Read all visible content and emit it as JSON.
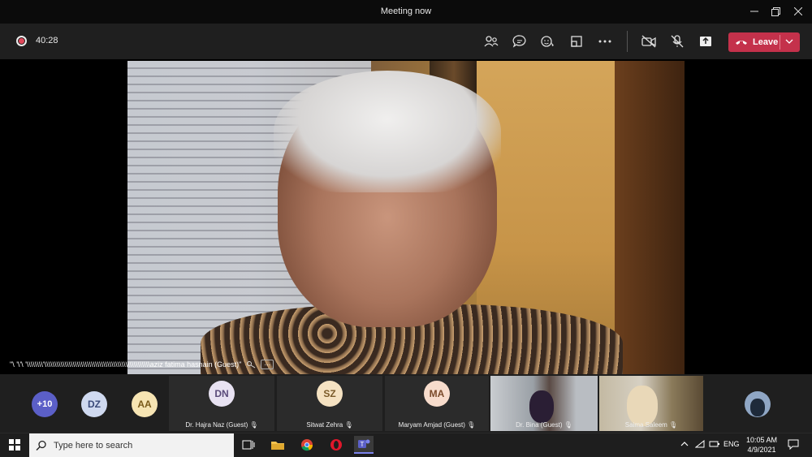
{
  "window": {
    "title": "Meeting now",
    "minimize": "—",
    "maximize": "❐",
    "close": "✕"
  },
  "toolbar": {
    "timer": "40:28",
    "leave_label": "Leave",
    "icons": [
      "people-icon",
      "chat-icon",
      "reactions-icon",
      "room-icon",
      "more-icon",
      "camera-off-icon",
      "mic-off-icon",
      "share-icon"
    ]
  },
  "stage": {
    "speaker_name": "\"\\ '\\'\\ '\\\\\\\\\\\\\\\\'\\\\\\\\\\\\\\\\\\\\\\\\\\\\\\\\\\\\\\\\\\\\\\\\\\\\\\\\\\\\\\\\\\\\\\\\\\\\\\\\\\\\\\\\\\\\\\\\\\\\\\\\aziz fatima hasnain (Guest)\"",
    "more": "···"
  },
  "participants": {
    "overflow": "+10",
    "avatars": [
      {
        "initials": "DZ",
        "bg": "#cfd9ef",
        "fg": "#3a4a7a"
      },
      {
        "initials": "AA",
        "bg": "#f6e4b3",
        "fg": "#7a5a1a"
      }
    ],
    "tiles": [
      {
        "initials": "DN",
        "name": "Dr. Hajra Naz (Guest)",
        "bg": "#e8e2f2",
        "fg": "#5a4a7a"
      },
      {
        "initials": "SZ",
        "name": "Sitwat Zehra",
        "bg": "#f5e2c2",
        "fg": "#7a5a2a"
      },
      {
        "initials": "MA",
        "name": "Maryam Amjad (Guest)",
        "bg": "#f7dccc",
        "fg": "#7a4a2a"
      }
    ],
    "cams": [
      {
        "name": "Dr. Bina (Guest)"
      },
      {
        "name": "Saima Saleem"
      }
    ],
    "overflow_bg": "#5b5fc7"
  },
  "taskbar": {
    "search_placeholder": "Type here to search",
    "time": "10:05 AM",
    "date": "4/9/2021",
    "lang": "ENG"
  },
  "colors": {
    "leave": "#c4314b",
    "accent": "#5b5fc7"
  }
}
